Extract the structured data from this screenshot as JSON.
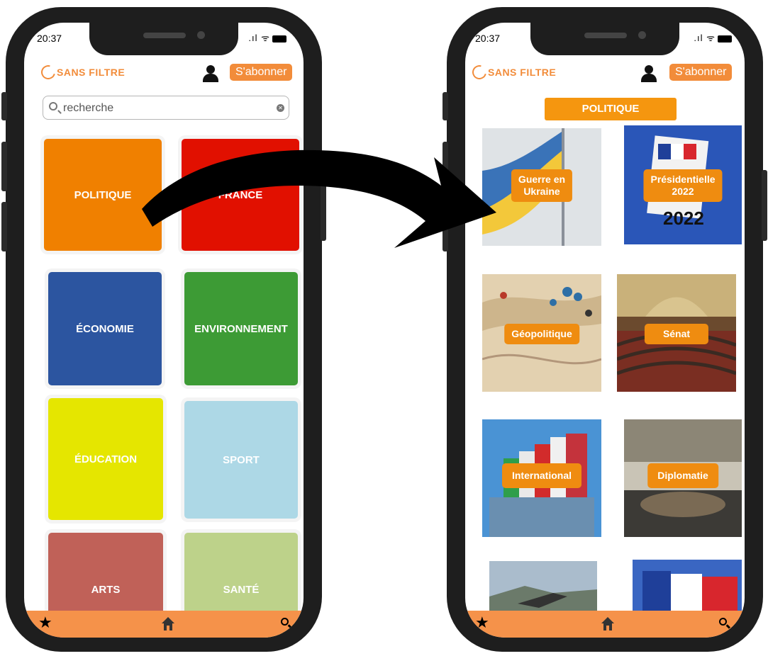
{
  "status": {
    "time": "20:37",
    "signal": ".ıl ᯤ"
  },
  "app": {
    "brand": "SANS FILTRE",
    "subscribe_label": "S'abonner"
  },
  "search": {
    "placeholder": "recherche",
    "clear": "✕"
  },
  "categories": [
    {
      "label": "POLITIQUE",
      "color": "#f08000"
    },
    {
      "label": "FRANCE",
      "color": "#e11000"
    },
    {
      "label": "ÉCONOMIE",
      "color": "#2c55a0"
    },
    {
      "label": "ENVIRONNEMENT",
      "color": "#3d9b35"
    },
    {
      "label": "ÉDUCATION",
      "color": "#e5e600"
    },
    {
      "label": "SPORT",
      "color": "#add8e6"
    },
    {
      "label": "ARTS",
      "color": "#c06158"
    },
    {
      "label": "SANTÉ",
      "color": "#bdd28a"
    }
  ],
  "section": {
    "title": "POLITIQUE"
  },
  "topics": [
    {
      "label_lines": [
        "Guerre en",
        "Ukraine"
      ]
    },
    {
      "label_lines": [
        "Présidentielle",
        "2022"
      ]
    },
    {
      "label_lines": [
        "Géopolitique"
      ]
    },
    {
      "label_lines": [
        "Sénat"
      ]
    },
    {
      "label_lines": [
        "International"
      ]
    },
    {
      "label_lines": [
        "Diplomatie"
      ]
    }
  ],
  "ballot_text": "2022",
  "icons": {
    "favorites": "star-icon",
    "home": "home-icon",
    "search": "search-icon",
    "user": "user-icon"
  },
  "colors": {
    "accent": "#f28c3a",
    "bar": "#f5924a",
    "section_button": "#f5960f"
  }
}
